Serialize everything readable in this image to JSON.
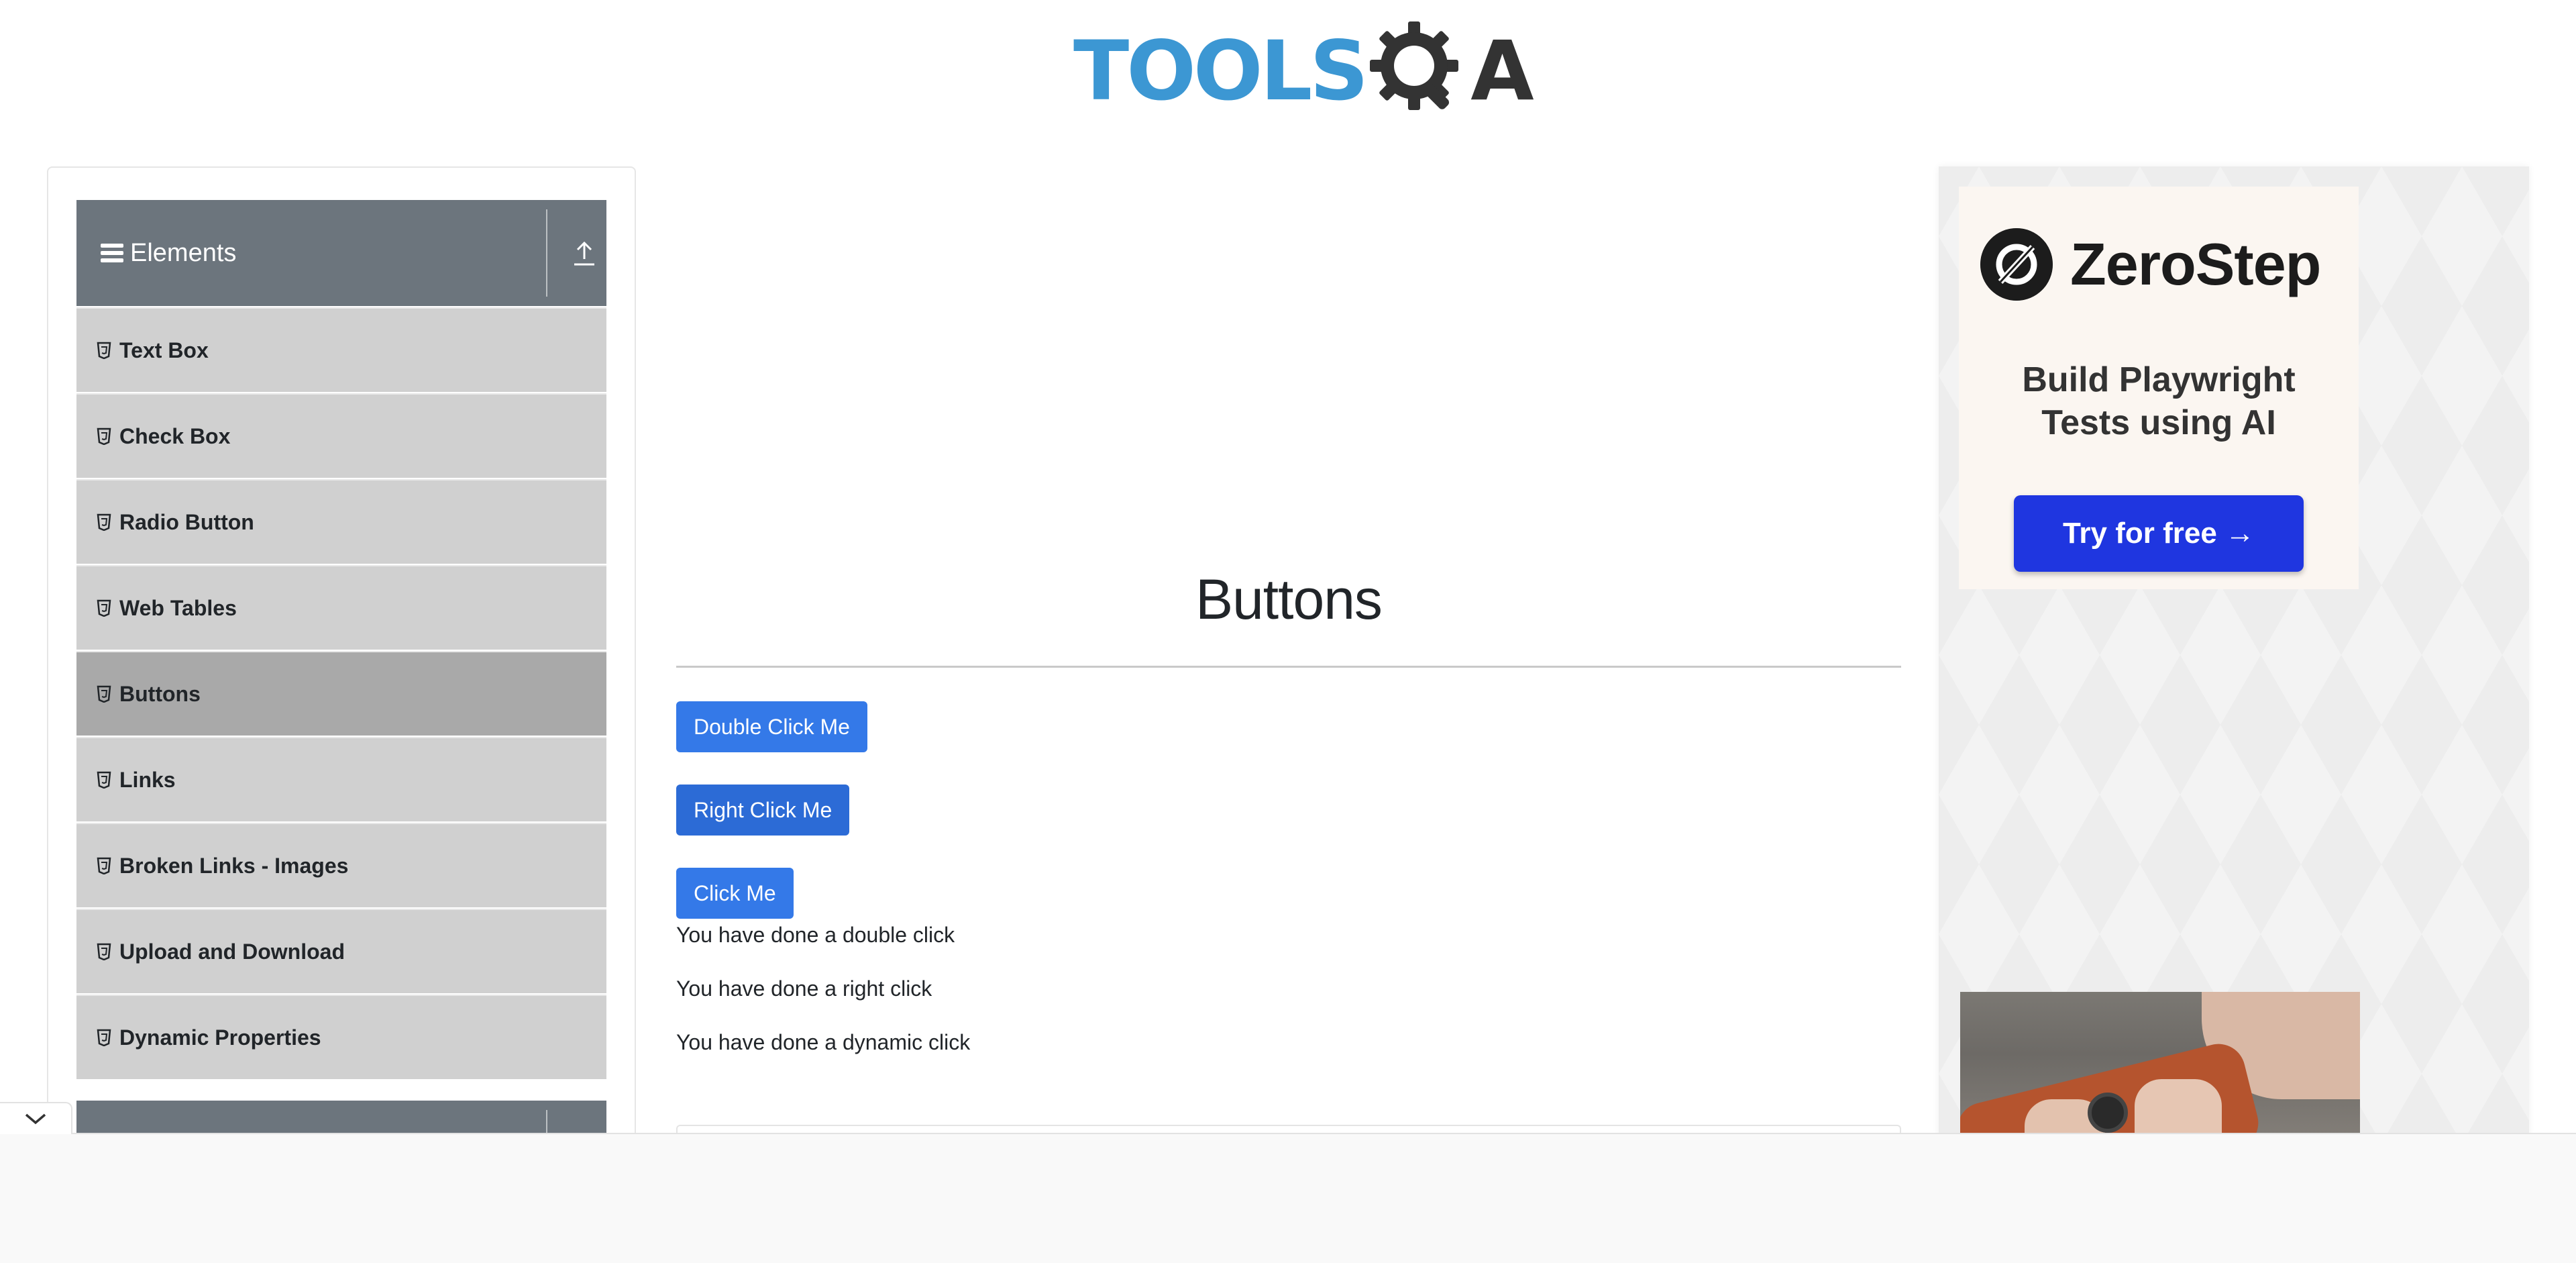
{
  "header": {
    "logo_text_tools": "TOOLS",
    "logo_text_a": "A",
    "logo_color_tools": "#3c97d3",
    "logo_color_dark": "#333333"
  },
  "sidebar": {
    "group_title": "Elements",
    "group_icon": "hamburger-icon",
    "collapse_icon": "upload-arrow-icon",
    "item_icon": "html5-shield-icon",
    "items": [
      {
        "label": "Text Box",
        "active": false
      },
      {
        "label": "Check Box",
        "active": false
      },
      {
        "label": "Radio Button",
        "active": false
      },
      {
        "label": "Web Tables",
        "active": false
      },
      {
        "label": "Buttons",
        "active": true
      },
      {
        "label": "Links",
        "active": false
      },
      {
        "label": "Broken Links - Images",
        "active": false
      },
      {
        "label": "Upload and Download",
        "active": false
      },
      {
        "label": "Dynamic Properties",
        "active": false
      }
    ]
  },
  "main": {
    "title": "Buttons",
    "buttons": {
      "double_click": "Double Click Me",
      "right_click": "Right Click Me",
      "click": "Click Me"
    },
    "messages": {
      "double_click": "You have done a double click",
      "right_click": "You have done a right click",
      "dynamic_click": "You have done a dynamic click"
    },
    "button_color": "#3479e8"
  },
  "ads": {
    "zerostep": {
      "brand": "ZeroStep",
      "tagline_line1": "Build Playwright",
      "tagline_line2": "Tests using AI",
      "cta": "Try for free →",
      "cta_color": "#1f36e0"
    }
  },
  "footer": {
    "toggle_icon": "chevron-down-icon"
  }
}
